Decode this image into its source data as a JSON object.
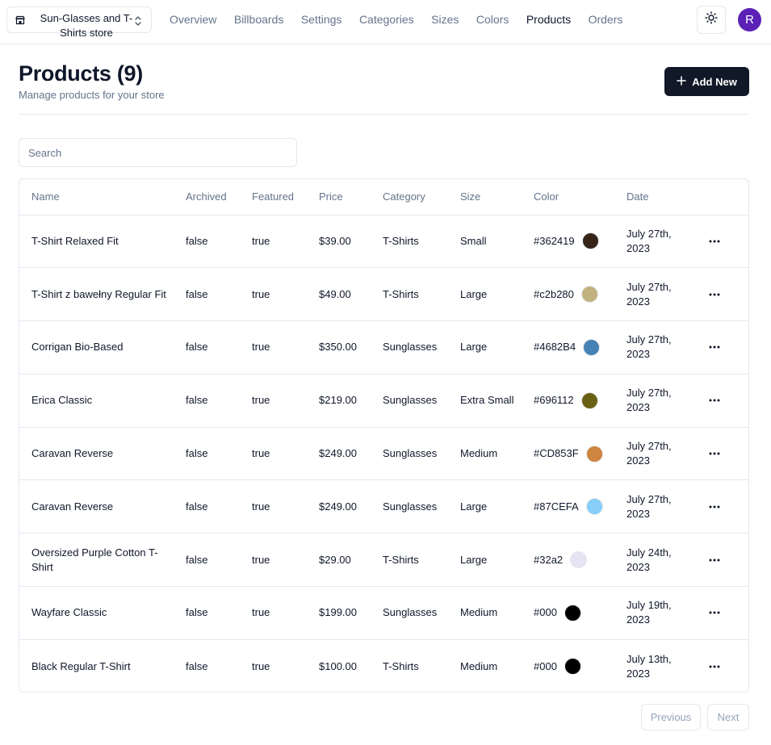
{
  "store": {
    "name": "Sun-Glasses and T-Shirts store"
  },
  "nav": [
    {
      "label": "Overview",
      "active": false
    },
    {
      "label": "Billboards",
      "active": false
    },
    {
      "label": "Settings",
      "active": false
    },
    {
      "label": "Categories",
      "active": false
    },
    {
      "label": "Sizes",
      "active": false
    },
    {
      "label": "Colors",
      "active": false
    },
    {
      "label": "Products",
      "active": true
    },
    {
      "label": "Orders",
      "active": false
    }
  ],
  "user": {
    "initial": "R"
  },
  "header": {
    "title": "Products (9)",
    "description": "Manage products for your store",
    "add_label": "Add New"
  },
  "search": {
    "placeholder": "Search",
    "value": ""
  },
  "table": {
    "columns": [
      "Name",
      "Archived",
      "Featured",
      "Price",
      "Category",
      "Size",
      "Color",
      "Date"
    ],
    "rows": [
      {
        "name": "T-Shirt Relaxed Fit",
        "archived": "false",
        "featured": "true",
        "price": "$39.00",
        "category": "T-Shirts",
        "size": "Small",
        "color": "#362419",
        "date": "July 27th, 2023"
      },
      {
        "name": "T-Shirt z bawełny Regular Fit",
        "archived": "false",
        "featured": "true",
        "price": "$49.00",
        "category": "T-Shirts",
        "size": "Large",
        "color": "#c2b280",
        "date": "July 27th, 2023"
      },
      {
        "name": "Corrigan Bio-Based",
        "archived": "false",
        "featured": "true",
        "price": "$350.00",
        "category": "Sunglasses",
        "size": "Large",
        "color": "#4682B4",
        "date": "July 27th, 2023"
      },
      {
        "name": "Erica Classic",
        "archived": "false",
        "featured": "true",
        "price": "$219.00",
        "category": "Sunglasses",
        "size": "Extra Small",
        "color": "#696112",
        "date": "July 27th, 2023"
      },
      {
        "name": "Caravan Reverse",
        "archived": "false",
        "featured": "true",
        "price": "$249.00",
        "category": "Sunglasses",
        "size": "Medium",
        "color": "#CD853F",
        "date": "July 27th, 2023"
      },
      {
        "name": "Caravan Reverse",
        "archived": "false",
        "featured": "true",
        "price": "$249.00",
        "category": "Sunglasses",
        "size": "Large",
        "color": "#87CEFA",
        "date": "July 27th, 2023"
      },
      {
        "name": "Oversized Purple Cotton T-Shirt",
        "archived": "false",
        "featured": "true",
        "price": "$29.00",
        "category": "T-Shirts",
        "size": "Large",
        "color": "#32a2",
        "swatch": "#e6e3f5",
        "date": "July 24th, 2023"
      },
      {
        "name": "Wayfare Classic",
        "archived": "false",
        "featured": "true",
        "price": "$199.00",
        "category": "Sunglasses",
        "size": "Medium",
        "color": "#000",
        "date": "July 19th, 2023"
      },
      {
        "name": "Black Regular T-Shirt",
        "archived": "false",
        "featured": "true",
        "price": "$100.00",
        "category": "T-Shirts",
        "size": "Medium",
        "color": "#000",
        "date": "July 13th, 2023"
      }
    ]
  },
  "pagination": {
    "previous": "Previous",
    "next": "Next"
  },
  "colors": {
    "accent": "#111827",
    "avatar": "#5b21b6",
    "muted": "#64748b",
    "border": "#e2e8f0"
  }
}
